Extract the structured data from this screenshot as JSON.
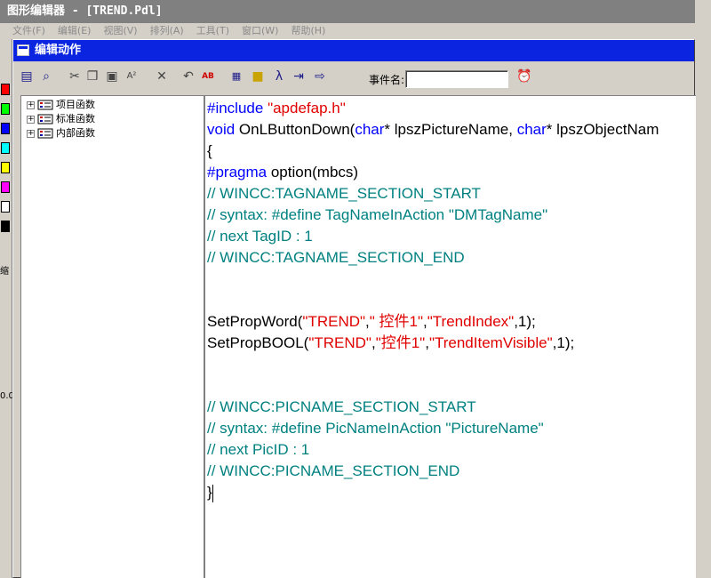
{
  "app": {
    "title": "图形编辑器 - [TREND.Pdl]",
    "menu": [
      "文件(F)",
      "编辑(E)",
      "视图(V)",
      "排列(A)",
      "工具(T)",
      "窗口(W)",
      "帮助(H)"
    ],
    "palette_colors": [
      "#ff0000",
      "#00ff00",
      "#0000ff",
      "#00ffff",
      "#ffff00",
      "#ff00ff",
      "#ffffff",
      "#000000"
    ],
    "palette_label": "缩",
    "palette_number": "0.0"
  },
  "dialog": {
    "title": "编辑动作",
    "event_label": "事件名:",
    "event_value": "",
    "toolbar_icons": [
      "save-icon",
      "search-icon",
      "cut-icon",
      "copy-icon",
      "paste-icon",
      "abc-icon",
      "delete-icon",
      "undo-icon",
      "abc-color-icon",
      "tag-icon",
      "cube-icon",
      "lambda-icon",
      "import-icon",
      "export-icon",
      "alarm-icon"
    ]
  },
  "tree": {
    "items": [
      "项目函数",
      "标准函数",
      "内部函数"
    ]
  },
  "code": {
    "l1_kw": "#include ",
    "l1_str": "\"apdefap.h\"",
    "l2_kw": "void",
    "l2_a": " OnLButtonDown(",
    "l2_kw2": "char",
    "l2_b": "* lpszPictureName, ",
    "l2_kw3": "char",
    "l2_c": "* lpszObjectNam",
    "l3": "{",
    "l4_kw": "#pragma",
    "l4_a": " option(mbcs)",
    "l5": "// WINCC:TAGNAME_SECTION_START",
    "l6": "// syntax: #define TagNameInAction \"DMTagName\"",
    "l7": "// next TagID : 1",
    "l8": "// WINCC:TAGNAME_SECTION_END",
    "l9_a": "SetPropWord(",
    "l9_s1": "\"TREND\"",
    "l9_b": ",",
    "l9_s2": "\" 控件1\"",
    "l9_c": ",",
    "l9_s3": "\"TrendIndex\"",
    "l9_d": ",1);",
    "l10_a": "SetPropBOOL(",
    "l10_s1": "\"TREND\"",
    "l10_b": ",",
    "l10_s2": "\"控件1\"",
    "l10_c": ",",
    "l10_s3": "\"TrendItemVisible\"",
    "l10_d": ",1);",
    "l11": "// WINCC:PICNAME_SECTION_START",
    "l12": "// syntax: #define PicNameInAction \"PictureName\"",
    "l13": "// next PicID : 1",
    "l14": "// WINCC:PICNAME_SECTION_END",
    "l15": "}"
  }
}
